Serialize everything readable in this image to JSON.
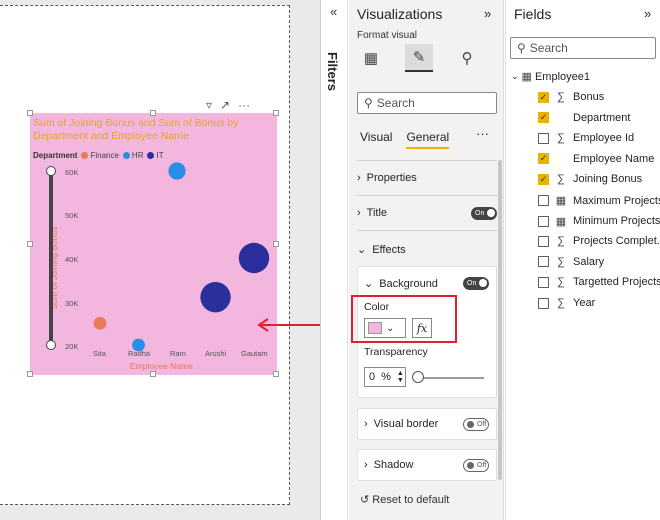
{
  "visual": {
    "title": "Sum of Joining Bonus and Sum of Bonus by Department and Employee Name",
    "legend_title": "Department",
    "legend": [
      {
        "name": "Finance",
        "color": "#e8795a"
      },
      {
        "name": "HR",
        "color": "#2a8de8"
      },
      {
        "name": "IT",
        "color": "#2b2f9e"
      }
    ],
    "y_axis_title": "Sum of Joining Bonus",
    "x_axis_title": "Employee Name",
    "y_ticks": [
      "60K",
      "50K",
      "40K",
      "30K",
      "20K"
    ],
    "x_ticks": [
      "Sita",
      "Radha",
      "Ram",
      "Arushi",
      "Gautam"
    ],
    "background_color": "#f3b6de",
    "toolbar_icons": [
      "filter-icon",
      "focus-mode-icon",
      "more-options-icon"
    ]
  },
  "chart_data": {
    "type": "scatter",
    "title": "Sum of Joining Bonus and Sum of Bonus by Department and Employee Name",
    "xlabel": "Employee Name",
    "ylabel": "Sum of Joining Bonus",
    "categories": [
      "Sita",
      "Radha",
      "Ram",
      "Arushi",
      "Gautam"
    ],
    "ylim": [
      20000,
      60000
    ],
    "points": [
      {
        "x": "Sita",
        "y": 25000,
        "series": "Finance",
        "size": 2
      },
      {
        "x": "Radha",
        "y": 20000,
        "series": "HR",
        "size": 2
      },
      {
        "x": "Ram",
        "y": 60000,
        "series": "HR",
        "size": 3
      },
      {
        "x": "Arushi",
        "y": 31000,
        "series": "IT",
        "size": 6
      },
      {
        "x": "Gautam",
        "y": 40000,
        "series": "IT",
        "size": 6
      }
    ],
    "legend_position": "top-left"
  },
  "filters": {
    "label": "Filters"
  },
  "visualizations": {
    "title": "Visualizations",
    "format_visual_label": "Format visual",
    "search_placeholder": "Search",
    "tabs": [
      "Visual",
      "General"
    ],
    "active_tab": "General",
    "sections": {
      "properties": "Properties",
      "title": "Title",
      "title_toggle": "On",
      "effects": "Effects",
      "background": "Background",
      "background_toggle": "On",
      "color_label": "Color",
      "fx_label": "fx",
      "transparency_label": "Transparency",
      "transparency_value": "0",
      "transparency_unit": "%",
      "visual_border": "Visual border",
      "visual_border_toggle": "Off",
      "shadow": "Shadow",
      "shadow_toggle": "Off"
    },
    "reset_label": "Reset to default"
  },
  "fields": {
    "title": "Fields",
    "search_placeholder": "Search",
    "table_name": "Employee1",
    "items": [
      {
        "label": "Bonus",
        "checked": true,
        "icon": "sigma-icon"
      },
      {
        "label": "Department",
        "checked": true,
        "icon": ""
      },
      {
        "label": "Employee Id",
        "checked": false,
        "icon": "sigma-icon"
      },
      {
        "label": "Employee Name",
        "checked": true,
        "icon": ""
      },
      {
        "label": "Joining Bonus",
        "checked": true,
        "icon": "sigma-icon"
      },
      {
        "label": "Maximum Projects",
        "checked": false,
        "icon": "calculator-icon"
      },
      {
        "label": "Minimum Projects",
        "checked": false,
        "icon": "calculator-icon"
      },
      {
        "label": "Projects Complet...",
        "checked": false,
        "icon": "sigma-icon"
      },
      {
        "label": "Salary",
        "checked": false,
        "icon": "sigma-icon"
      },
      {
        "label": "Targetted Projects",
        "checked": false,
        "icon": "sigma-icon"
      },
      {
        "label": "Year",
        "checked": false,
        "icon": "sigma-icon"
      }
    ]
  }
}
